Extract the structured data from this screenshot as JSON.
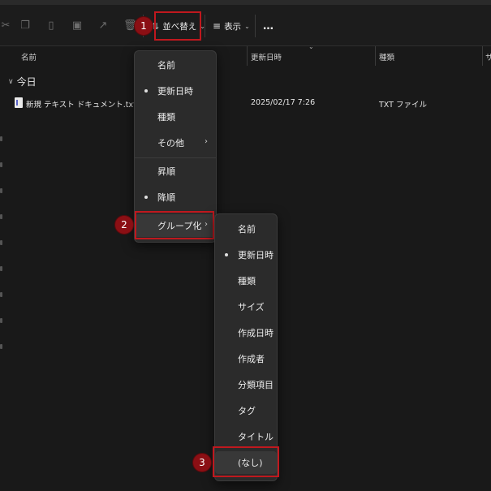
{
  "toolbar": {
    "sort_label": "並べ替え",
    "view_label": "表示",
    "more_label": "…",
    "icons": [
      "scissors-icon",
      "copy-icon",
      "paste-icon",
      "rename-icon",
      "share-icon",
      "delete-icon",
      "sort-arrows-icon",
      "list-view-icon",
      "more-icon"
    ]
  },
  "columns": {
    "name": "名前",
    "modified": "更新日時",
    "type": "種類",
    "size_partial": "サ"
  },
  "group": {
    "label": "今日"
  },
  "file": {
    "name": "新規 テキスト ドキュメント.txt",
    "modified": "2025/02/17 7:26",
    "type": "TXT ファイル"
  },
  "sort_menu": {
    "items": [
      "名前",
      "更新日時",
      "種類",
      "その他",
      "昇順",
      "降順",
      "グループ化"
    ],
    "selected_sort": "更新日時",
    "selected_order": "降順"
  },
  "group_menu": {
    "items": [
      "名前",
      "更新日時",
      "種類",
      "サイズ",
      "作成日時",
      "作成者",
      "分類項目",
      "タグ",
      "タイトル",
      "(なし)"
    ],
    "selected": "更新日時"
  },
  "steps": {
    "s1": "1",
    "s2": "2",
    "s3": "3"
  },
  "colors": {
    "highlight": "#c0181e",
    "badge": "#8b0f14"
  }
}
